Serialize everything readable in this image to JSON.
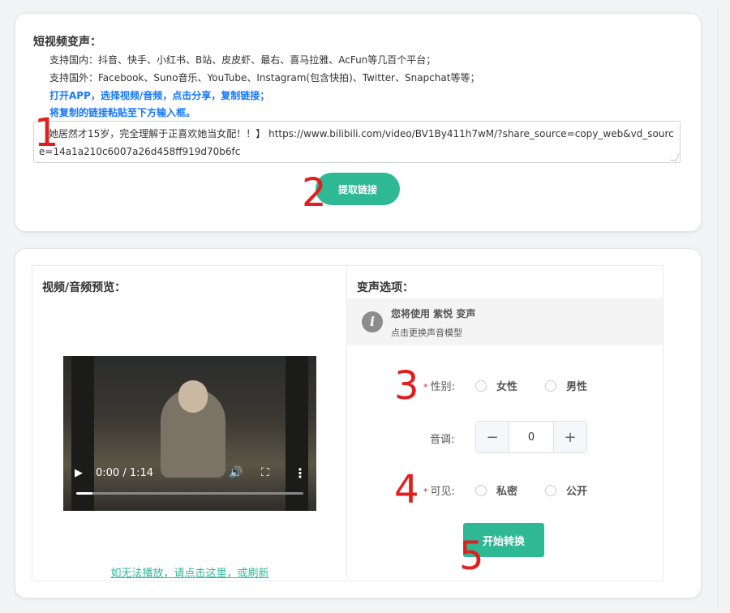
{
  "extract": {
    "title": "短视频变声：",
    "support_domestic": "支持国内：抖音、快手、小红书、B站、皮皮虾、最右、喜马拉雅、AcFun等几百个平台；",
    "support_foreign": "支持国外：Facebook、Suno音乐、YouTube、Instagram(包含快拍)、Twitter、Snapchat等等；",
    "instruction1": "打开APP，选择视频/音频，点击分享，复制链接；",
    "instruction2": "将复制的链接粘贴至下方输入框。",
    "input_value": "【她居然才15岁，完全理解于正喜欢她当女配！！】 https://www.bilibili.com/video/BV1By411h7wM/?share_source=copy_web&vd_source=14a1a210c6007a26d458ff919d70b6fc",
    "extract_button": "提取链接"
  },
  "preview": {
    "title": "视频/音频预览：",
    "video_time": "0:00 / 1:14",
    "progress": 0.07,
    "fallback_link": "如无法播放，请点击这里，或刷新"
  },
  "options": {
    "title": "变声选项：",
    "info_line1": "您将使用 紫悦 变声",
    "info_line2": "点击更换声音模型",
    "gender_label": "性别:",
    "gender_female": "女性",
    "gender_male": "男性",
    "pitch_label": "音调:",
    "pitch_value": "0",
    "pitch_minus": "−",
    "pitch_plus": "+",
    "visibility_label": "可见:",
    "visibility_private": "私密",
    "visibility_public": "公开",
    "required_mark": "*",
    "convert_button": "开始转换"
  },
  "markers": [
    "1",
    "2",
    "3",
    "4",
    "5"
  ],
  "colors": {
    "accent": "#2eb895",
    "link_blue": "#1677ff",
    "marker_red": "#e02020"
  }
}
